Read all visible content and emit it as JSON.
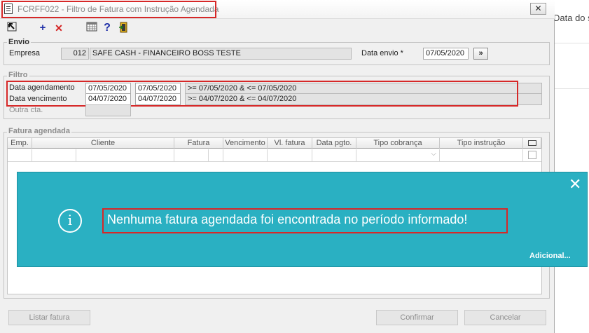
{
  "background_app": {
    "text": "Data do s"
  },
  "window": {
    "title": "FCRFF022 - Filtro de Fatura com Instrução Agendada",
    "close_glyph": "✕"
  },
  "toolbar": {
    "icons": [
      "cursor-icon",
      "add-icon",
      "delete-icon",
      "calendar-icon",
      "help-icon",
      "exit-icon"
    ],
    "add_glyph": "+",
    "delete_glyph": "✕",
    "help_glyph": "?"
  },
  "envio": {
    "group_label": "Envio",
    "empresa_label": "Empresa",
    "empresa_code": "012",
    "empresa_name": "SAFE CASH - FINANCEIRO BOSS TESTE",
    "data_envio_label": "Data envio *",
    "data_envio_value": "07/05/2020",
    "next_button": "»"
  },
  "filtro": {
    "group_label": "Filtro",
    "agendamento_label": "Data agendamento",
    "agendamento_from": "07/05/2020",
    "agendamento_to": "07/05/2020",
    "agendamento_expr": ">= 07/05/2020 & <= 07/05/2020",
    "vencimento_label": "Data vencimento",
    "vencimento_from": "04/07/2020",
    "vencimento_to": "04/07/2020",
    "vencimento_expr": ">= 04/07/2020 & <= 04/07/2020",
    "outra_cta_label": "Outra cta."
  },
  "fatura_agendada": {
    "group_label": "Fatura agendada",
    "columns": [
      "Emp.",
      "Cliente",
      "Fatura",
      "Vencimento",
      "Vl. fatura",
      "Data pgto.",
      "Tipo cobrança",
      "Tipo instrução"
    ]
  },
  "notification": {
    "message": "Nenhuma fatura agendada foi encontrada no período informado!",
    "more_link": "Adicional...",
    "close_glyph": "✕",
    "info_glyph": "i"
  },
  "footer": {
    "listar": "Listar fatura",
    "confirmar": "Confirmar",
    "cancelar": "Cancelar"
  },
  "colors": {
    "toast_bg": "#2ab0c2",
    "highlight_red": "#d62828",
    "window_bg": "#f0f0f0"
  }
}
